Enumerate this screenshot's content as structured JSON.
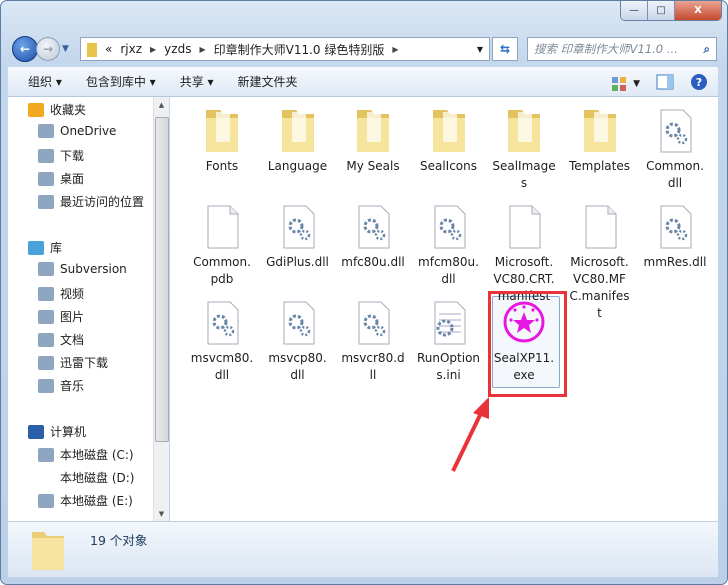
{
  "window": {
    "minimize": "—",
    "maximize": "□",
    "close": "X"
  },
  "address": {
    "overflow": "«",
    "crumbs": [
      "rjxz",
      "yzds",
      "印章制作大师V11.0 绿色特别版"
    ]
  },
  "search": {
    "placeholder": "搜索 印章制作大师V11.0 ..."
  },
  "toolbar": {
    "organize": "组织 ▾",
    "include": "包含到库中 ▾",
    "share": "共享 ▾",
    "new_folder": "新建文件夹"
  },
  "sidebar": {
    "favorites": {
      "label": "收藏夹",
      "items": [
        "OneDrive",
        "下载",
        "桌面",
        "最近访问的位置"
      ]
    },
    "libraries": {
      "label": "库",
      "items": [
        "Subversion",
        "视频",
        "图片",
        "文档",
        "迅雷下载",
        "音乐"
      ]
    },
    "computer": {
      "label": "计算机",
      "items": [
        "本地磁盘 (C:)",
        "本地磁盘 (D:)",
        "本地磁盘 (E:)"
      ],
      "selected": "本地磁盘 (D:)"
    }
  },
  "files": [
    {
      "name": "Fonts",
      "type": "folder"
    },
    {
      "name": "Language",
      "type": "folder"
    },
    {
      "name": "My Seals",
      "type": "folder"
    },
    {
      "name": "SealIcons",
      "type": "folder"
    },
    {
      "name": "SealImages",
      "type": "folder"
    },
    {
      "name": "Templates",
      "type": "folder"
    },
    {
      "name": "Common.dll",
      "type": "dll"
    },
    {
      "name": "Common.pdb",
      "type": "blank"
    },
    {
      "name": "GdiPlus.dll",
      "type": "dll"
    },
    {
      "name": "mfc80u.dll",
      "type": "dll"
    },
    {
      "name": "mfcm80u.dll",
      "type": "dll"
    },
    {
      "name": "Microsoft.VC80.CRT.manifest",
      "type": "blank"
    },
    {
      "name": "Microsoft.VC80.MFC.manifest",
      "type": "blank"
    },
    {
      "name": "mmRes.dll",
      "type": "dll"
    },
    {
      "name": "msvcm80.dll",
      "type": "dll"
    },
    {
      "name": "msvcp80.dll",
      "type": "dll"
    },
    {
      "name": "msvcr80.dll",
      "type": "dll"
    },
    {
      "name": "RunOptions.ini",
      "type": "ini"
    },
    {
      "name": "SealXP11.exe",
      "type": "exe",
      "selected": true
    }
  ],
  "status": {
    "count": "19 个对象"
  },
  "colors": {
    "highlight": "#e8333a",
    "seal": "#e817e0",
    "folder": "#f2d46b"
  }
}
